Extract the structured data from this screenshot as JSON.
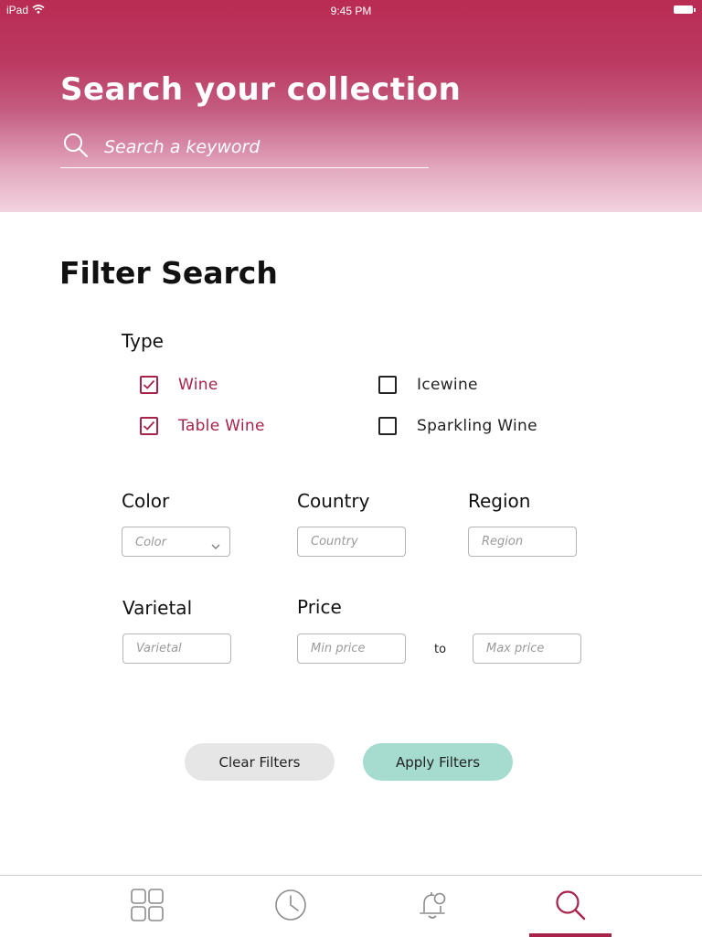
{
  "status_bar": {
    "device": "iPad",
    "time": "9:45 PM"
  },
  "header": {
    "title": "Search your collection",
    "search_placeholder": "Search a keyword"
  },
  "filter": {
    "title": "Filter Search",
    "type": {
      "label": "Type",
      "options": [
        {
          "label": "Wine",
          "checked": true
        },
        {
          "label": "Icewine",
          "checked": false
        },
        {
          "label": "Table Wine",
          "checked": true
        },
        {
          "label": "Sparkling Wine",
          "checked": false
        }
      ]
    },
    "color": {
      "label": "Color",
      "placeholder": "Color"
    },
    "country": {
      "label": "Country",
      "placeholder": "Country"
    },
    "region": {
      "label": "Region",
      "placeholder": "Region"
    },
    "varietal": {
      "label": "Varietal",
      "placeholder": "Varietal"
    },
    "price": {
      "label": "Price",
      "min_placeholder": "Min price",
      "max_placeholder": "Max price",
      "separator": "to"
    }
  },
  "buttons": {
    "clear": "Clear Filters",
    "apply": "Apply Filters"
  },
  "tabbar": {
    "tabs": [
      {
        "icon": "grid-icon",
        "active": false
      },
      {
        "icon": "clock-icon",
        "active": false
      },
      {
        "icon": "bell-icon",
        "active": false
      },
      {
        "icon": "search-icon",
        "active": true
      }
    ]
  },
  "colors": {
    "accent": "#a8234a",
    "apply_button": "#a5dccf",
    "clear_button": "#e6e6e6",
    "header_top": "#b92b53"
  }
}
